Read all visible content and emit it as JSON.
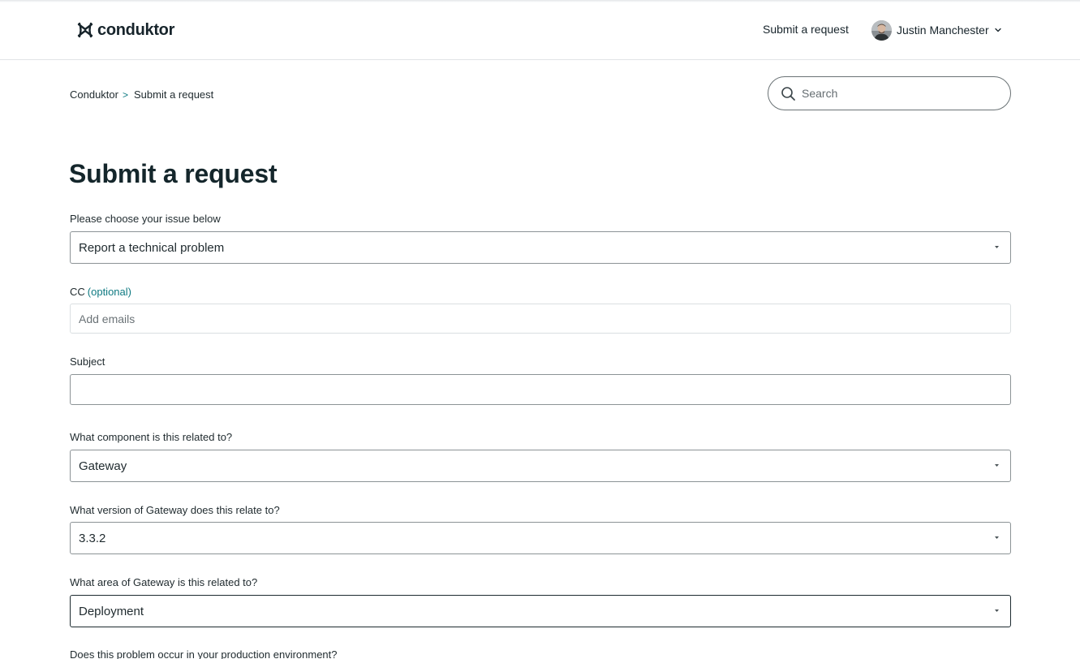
{
  "header": {
    "logo_text": "conduktor",
    "nav_submit_label": "Submit a request",
    "user_name": "Justin Manchester"
  },
  "breadcrumb": {
    "home": "Conduktor",
    "separator": ">",
    "current": "Submit a request"
  },
  "search": {
    "placeholder": "Search",
    "value": ""
  },
  "page": {
    "title": "Submit a request"
  },
  "form": {
    "issue": {
      "label": "Please choose your issue below",
      "value": "Report a technical problem"
    },
    "cc": {
      "label": "CC",
      "optional": "(optional)",
      "placeholder": "Add emails",
      "value": ""
    },
    "subject": {
      "label": "Subject",
      "value": ""
    },
    "component": {
      "label": "What component is this related to?",
      "value": "Gateway"
    },
    "version": {
      "label": "What version of Gateway does this relate to?",
      "value": "3.3.2"
    },
    "area": {
      "label": "What area of Gateway is this related to?",
      "value": "Deployment"
    },
    "production": {
      "label": "Does this problem occur in your production environment?"
    }
  },
  "colors": {
    "text": "#1f2a2e",
    "accent": "#0f7a82",
    "border": "#8c9396",
    "border_light": "#dadfe1"
  }
}
